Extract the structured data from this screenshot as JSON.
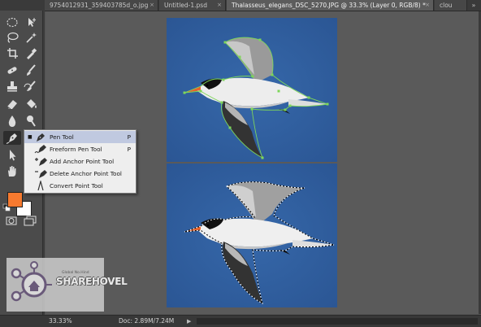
{
  "tabs": [
    {
      "label": "9754012931_359403785d_o.jpg",
      "active": false
    },
    {
      "label": "Untitled-1.psd",
      "active": false
    },
    {
      "label": "Thalasseus_elegans_DSC_5270.JPG @ 33.3% (Layer 0, RGB/8) *",
      "active": true
    },
    {
      "label": "clou",
      "active": false
    }
  ],
  "tab_close_glyph": "×",
  "tab_overflow_glyph": "»",
  "tools": [
    {
      "name": "ellipse-marquee-tool-icon"
    },
    {
      "name": "move-tool-icon"
    },
    {
      "name": "lasso-tool-icon"
    },
    {
      "name": "magic-wand-tool-icon"
    },
    {
      "name": "crop-tool-icon"
    },
    {
      "name": "eyedropper-tool-icon"
    },
    {
      "name": "spot-healing-tool-icon"
    },
    {
      "name": "brush-tool-icon"
    },
    {
      "name": "clone-stamp-tool-icon"
    },
    {
      "name": "history-brush-tool-icon"
    },
    {
      "name": "eraser-tool-icon"
    },
    {
      "name": "paint-bucket-tool-icon"
    },
    {
      "name": "blur-tool-icon"
    },
    {
      "name": "dodge-tool-icon"
    },
    {
      "name": "pen-tool-icon"
    },
    {
      "name": "type-tool-icon"
    },
    {
      "name": "path-selection-tool-icon"
    },
    {
      "name": "rectangle-tool-icon"
    },
    {
      "name": "hand-tool-icon"
    },
    {
      "name": "zoom-tool-icon"
    }
  ],
  "colors": {
    "foreground": "#f77a2f",
    "background": "#ffffff",
    "canvas_bg": "#2f5e9f"
  },
  "flyout": {
    "items": [
      {
        "label": "Pen Tool",
        "shortcut": "P",
        "active": true,
        "icon": "pen-icon"
      },
      {
        "label": "Freeform Pen Tool",
        "shortcut": "P",
        "active": false,
        "icon": "freeform-pen-icon"
      },
      {
        "label": "Add Anchor Point Tool",
        "shortcut": "",
        "active": false,
        "icon": "add-anchor-point-icon"
      },
      {
        "label": "Delete Anchor Point Tool",
        "shortcut": "",
        "active": false,
        "icon": "delete-anchor-point-icon"
      },
      {
        "label": "Convert Point Tool",
        "shortcut": "",
        "active": false,
        "icon": "convert-point-icon"
      }
    ],
    "active_mark": "■"
  },
  "status": {
    "zoom": "33.33%",
    "doc": "Doc: 2.89M/7.24M",
    "arrow": "▶"
  },
  "watermark": {
    "text": "SHAREHOVEL",
    "subtext": "Global No.Hind"
  }
}
